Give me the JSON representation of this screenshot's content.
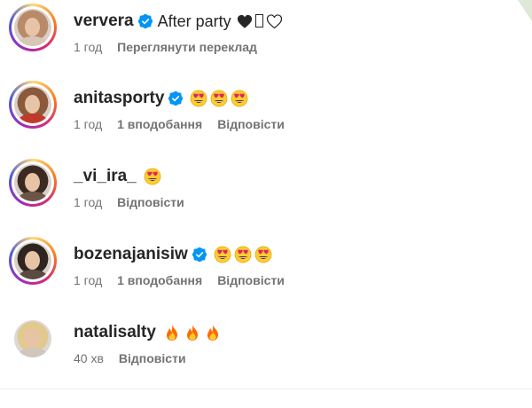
{
  "comments": [
    {
      "username": "ververa",
      "verified": true,
      "text": "After party",
      "emoji_suffix": [
        "black-heart-icon",
        "missing-glyph-box",
        "white-heart-icon"
      ],
      "time": "1 год",
      "actions": [
        "Переглянути переклад"
      ],
      "avatar_colors": {
        "hair": "#b98a6a",
        "clothes": "#d8c6b6"
      },
      "has_story_ring": true
    },
    {
      "username": "anitasporty",
      "verified": true,
      "text": "",
      "emoji_suffix": [
        "heart-eyes-emoji",
        "heart-eyes-emoji",
        "heart-eyes-emoji"
      ],
      "time": "1 год",
      "likes": "1 вподобання",
      "actions": [
        "Відповісти"
      ],
      "avatar_colors": {
        "hair": "#8a5a3b",
        "clothes": "#c0392b"
      },
      "has_story_ring": true
    },
    {
      "username": "_vi_ira_",
      "verified": false,
      "text": "",
      "emoji_suffix": [
        "heart-eyes-emoji"
      ],
      "time": "1 год",
      "actions": [
        "Відповісти"
      ],
      "avatar_colors": {
        "hair": "#3b2a22",
        "clothes": "#6b5547"
      },
      "has_story_ring": true
    },
    {
      "username": "bozenajanisiw",
      "verified": true,
      "text": "",
      "emoji_suffix": [
        "heart-eyes-emoji",
        "heart-eyes-emoji",
        "heart-eyes-emoji"
      ],
      "time": "1 год",
      "likes": "1 вподобання",
      "actions": [
        "Відповісти"
      ],
      "avatar_colors": {
        "hair": "#2e2520",
        "clothes": "#5a4a42"
      },
      "has_story_ring": true
    },
    {
      "username": "natalisalty",
      "verified": false,
      "text": "",
      "emoji_suffix": [
        "fire-emoji",
        "fire-emoji",
        "fire-emoji"
      ],
      "time": "40 хв",
      "actions": [
        "Відповісти"
      ],
      "avatar_colors": {
        "hair": "#e2c98f",
        "clothes": "#cfc7bd"
      },
      "has_story_ring": false
    }
  ],
  "colors": {
    "text_primary": "#262626",
    "text_secondary": "#737373",
    "verified_blue": "#0095f6",
    "emoji_yellow": "#ffcc33",
    "emoji_heart_red": "#e0245e",
    "fire_orange": "#ff6a00"
  }
}
